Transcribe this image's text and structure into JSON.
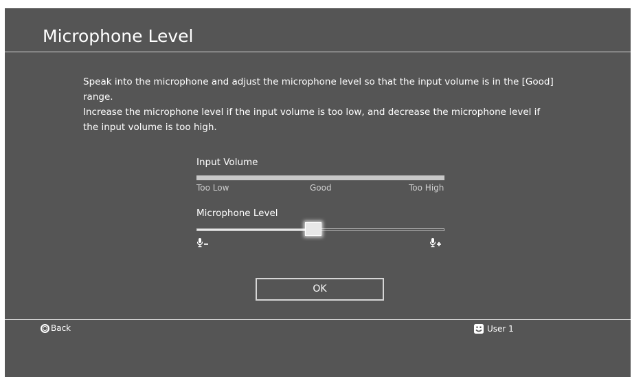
{
  "title": "Microphone Level",
  "instructions": {
    "line1": "Speak into the microphone and adjust the microphone level so that the input volume is in the [Good] range.",
    "line2": "Increase the microphone level if the input volume is too low, and decrease the microphone level if the input volume is too high."
  },
  "input_volume": {
    "label": "Input Volume",
    "range_labels": {
      "low": "Too Low",
      "good": "Good",
      "high": "Too High"
    },
    "level": 1.0
  },
  "microphone_level": {
    "label": "Microphone Level",
    "value": 0.47,
    "decrease_icon": "microphone-minus-icon",
    "increase_icon": "microphone-plus-icon"
  },
  "ok_label": "OK",
  "footer": {
    "back_label": "Back",
    "back_icon": "circle-button-icon",
    "user_label": "User 1",
    "user_icon": "smiley-user-icon"
  },
  "colors": {
    "background": "#555555",
    "text": "#ffffff",
    "divider": "#d8d8d8"
  }
}
